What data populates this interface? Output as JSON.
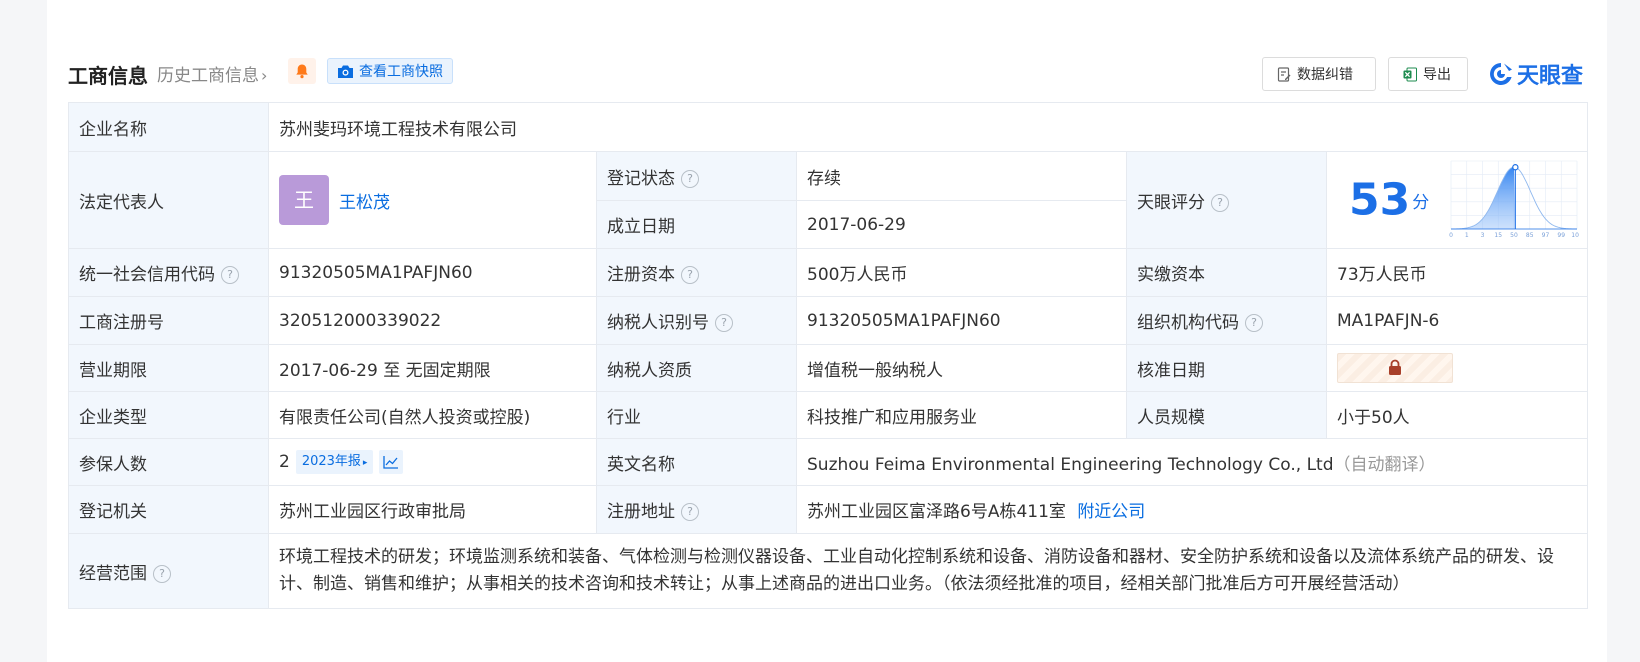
{
  "header": {
    "title": "工商信息",
    "history_link": "历史工商信息",
    "history_chevron": "›",
    "snapshot_label": "查看工商快照",
    "correct_label": "数据纠错",
    "export_label": "导出",
    "brand": "天眼查"
  },
  "rows": {
    "company_name": {
      "label": "企业名称",
      "value": "苏州斐玛环境工程技术有限公司"
    },
    "legal_rep": {
      "label": "法定代表人",
      "avatar_char": "王",
      "name": "王松茂"
    },
    "reg_status": {
      "label": "登记状态",
      "value": "存续"
    },
    "founded": {
      "label": "成立日期",
      "value": "2017-06-29"
    },
    "score": {
      "label": "天眼评分",
      "value": "53",
      "unit": "分"
    },
    "credit_code": {
      "label": "统一社会信用代码",
      "value": "91320505MA1PAFJN60"
    },
    "reg_capital": {
      "label": "注册资本",
      "value": "500万人民币"
    },
    "paid_capital": {
      "label": "实缴资本",
      "value": "73万人民币"
    },
    "reg_no": {
      "label": "工商注册号",
      "value": "320512000339022"
    },
    "taxpayer_id": {
      "label": "纳税人识别号",
      "value": "91320505MA1PAFJN60"
    },
    "org_code": {
      "label": "组织机构代码",
      "value": "MA1PAFJN-6"
    },
    "term": {
      "label": "营业期限",
      "value": "2017-06-29 至 无固定期限"
    },
    "taxpayer_type": {
      "label": "纳税人资质",
      "value": "增值税一般纳税人"
    },
    "approval_date": {
      "label": "核准日期"
    },
    "company_type": {
      "label": "企业类型",
      "value": "有限责任公司(自然人投资或控股)"
    },
    "industry": {
      "label": "行业",
      "value": "科技推广和应用服务业"
    },
    "staff_size": {
      "label": "人员规模",
      "value": "小于50人"
    },
    "insured": {
      "label": "参保人数",
      "value": "2",
      "report_badge": "2023年报",
      "report_arrow": "▸"
    },
    "english_name": {
      "label": "英文名称",
      "value": "Suzhou Feima Environmental Engineering Technology Co., Ltd",
      "note": "（自动翻译）"
    },
    "authority": {
      "label": "登记机关",
      "value": "苏州工业园区行政审批局"
    },
    "address": {
      "label": "注册地址",
      "value": "苏州工业园区富泽路6号A栋411室",
      "nearby_link": "附近公司"
    },
    "scope": {
      "label": "经营范围",
      "value": "环境工程技术的研发；环境监测系统和装备、气体检测与检测仪器设备、工业自动化控制系统和设备、消防设备和器材、安全防护系统和设备以及流体系统产品的研发、设计、制造、销售和维护；从事相关的技术咨询和技术转让；从事上述商品的进出口业务。（依法须经批准的项目，经相关部门批准后方可开展经营活动）"
    }
  },
  "help_glyph": "?",
  "score_chart": {
    "type": "area",
    "x_ticks": [
      "0",
      "1",
      "3",
      "15",
      "50",
      "85",
      "97",
      "99",
      "100"
    ],
    "marker_value": 53
  },
  "colors": {
    "accent": "#1c6fe6",
    "status_green": "#1aa35a",
    "label_bg": "#f2f7fd"
  }
}
